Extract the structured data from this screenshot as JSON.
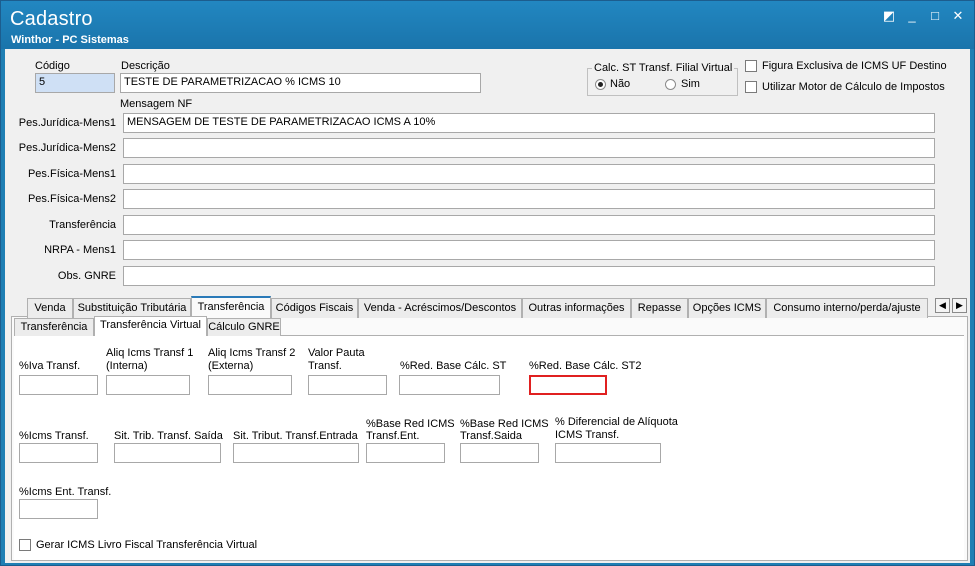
{
  "window": {
    "title": "Cadastro",
    "subtitle": "Winthor - PC Sistemas",
    "buttons": {
      "restore": "◩",
      "minimize": "_",
      "maximize": "□",
      "close": "✕"
    }
  },
  "header": {
    "codigo_label": "Código",
    "codigo_value": "5",
    "descricao_label": "Descrição",
    "descricao_value": "TESTE DE PARAMETRIZACAO % ICMS 10",
    "calc_st_group_label": "Calc. ST Transf. Filial Virtual",
    "radio_nao": "Não",
    "radio_sim": "Sim",
    "check_figura": "Figura Exclusiva de ICMS UF Destino",
    "check_motor": "Utilizar Motor de Cálculo de Impostos",
    "mensagem_nf_label": "Mensagem NF"
  },
  "messages": [
    {
      "label": "Pes.Jurídica-Mens1",
      "value": "MENSAGEM DE TESTE DE PARAMETRIZACAO ICMS A 10%"
    },
    {
      "label": "Pes.Jurídica-Mens2",
      "value": ""
    },
    {
      "label": "Pes.Física-Mens1",
      "value": ""
    },
    {
      "label": "Pes.Física-Mens2",
      "value": ""
    },
    {
      "label": "Transferência",
      "value": ""
    },
    {
      "label": "NRPA - Mens1",
      "value": ""
    },
    {
      "label": "Obs. GNRE",
      "value": ""
    }
  ],
  "tabs": [
    "Venda",
    "Substituição Tributária",
    "Transferência",
    "Códigos Fiscais",
    "Venda - Acréscimos/Descontos",
    "Outras informações",
    "Repasse",
    "Opções ICMS",
    "Consumo interno/perda/ajuste"
  ],
  "active_tab": "Transferência",
  "subtabs": [
    "Transferência",
    "Transferência Virtual",
    "Cálculo GNRE"
  ],
  "active_subtab": "Transferência Virtual",
  "fields": {
    "iva_transf": "%Iva Transf.",
    "aliq_icms_transf1_a": "Aliq Icms Transf 1",
    "aliq_icms_transf1_b": "(Interna)",
    "aliq_icms_transf2_a": "Aliq Icms Transf 2",
    "aliq_icms_transf2_b": "(Externa)",
    "valor_pauta_a": "Valor Pauta",
    "valor_pauta_b": "Transf.",
    "red_base_st": "%Red. Base Cálc. ST",
    "red_base_st2": "%Red. Base Cálc. ST2",
    "icms_transf": "%Icms Transf.",
    "sit_trib_saida": "Sit. Trib. Transf. Saída",
    "sit_trib_entrada": "Sit. Tribut. Transf.Entrada",
    "base_red_ent_a": "%Base Red ICMS",
    "base_red_ent_b": "Transf.Ent.",
    "base_red_saida_a": "%Base Red ICMS",
    "base_red_saida_b": "Transf.Saida",
    "dif_aliq_a": "% Diferencial de Alíquota",
    "dif_aliq_b": "ICMS Transf.",
    "icms_ent_transf": "%Icms Ent. Transf.",
    "gerar_icms_livro": "Gerar ICMS Livro Fiscal Transferência Virtual"
  },
  "colors": {
    "titlebar": "#1f7fb4",
    "highlight_border": "#e02020",
    "active_tab_border": "#2a7ab8"
  }
}
